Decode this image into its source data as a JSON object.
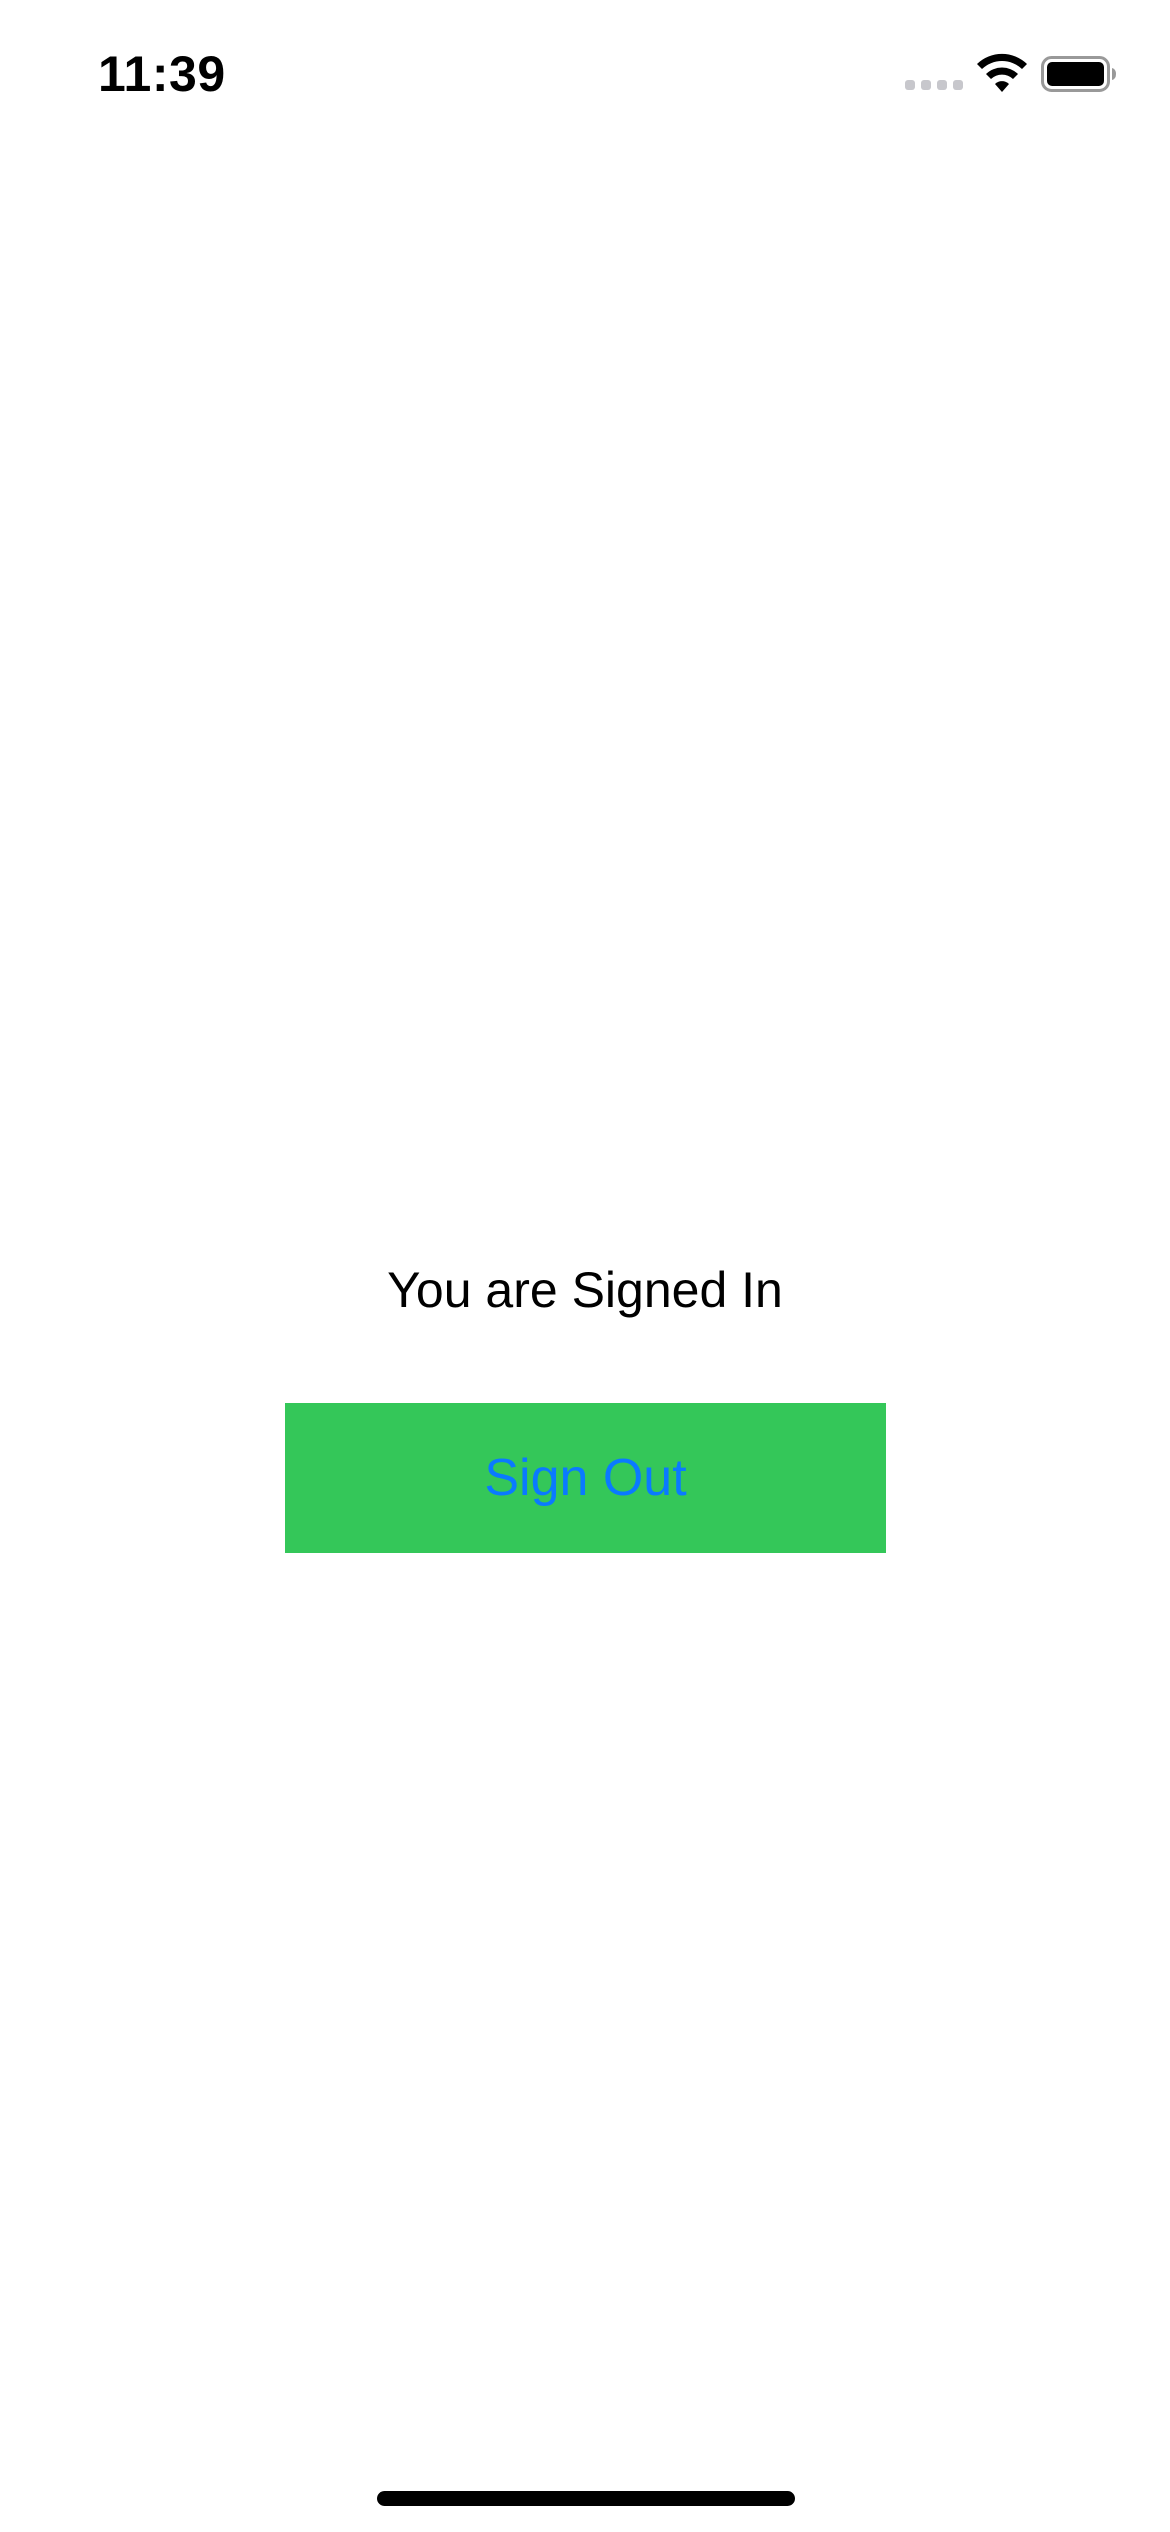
{
  "status_bar": {
    "time": "11:39",
    "icons": [
      "cellular-signal-icon",
      "wifi-icon",
      "battery-icon"
    ]
  },
  "main": {
    "message": "You are Signed In",
    "sign_out_button_label": "Sign Out"
  },
  "colors": {
    "button_background": "#34c759",
    "button_text": "#0a7aff",
    "text": "#000000",
    "background": "#ffffff"
  }
}
